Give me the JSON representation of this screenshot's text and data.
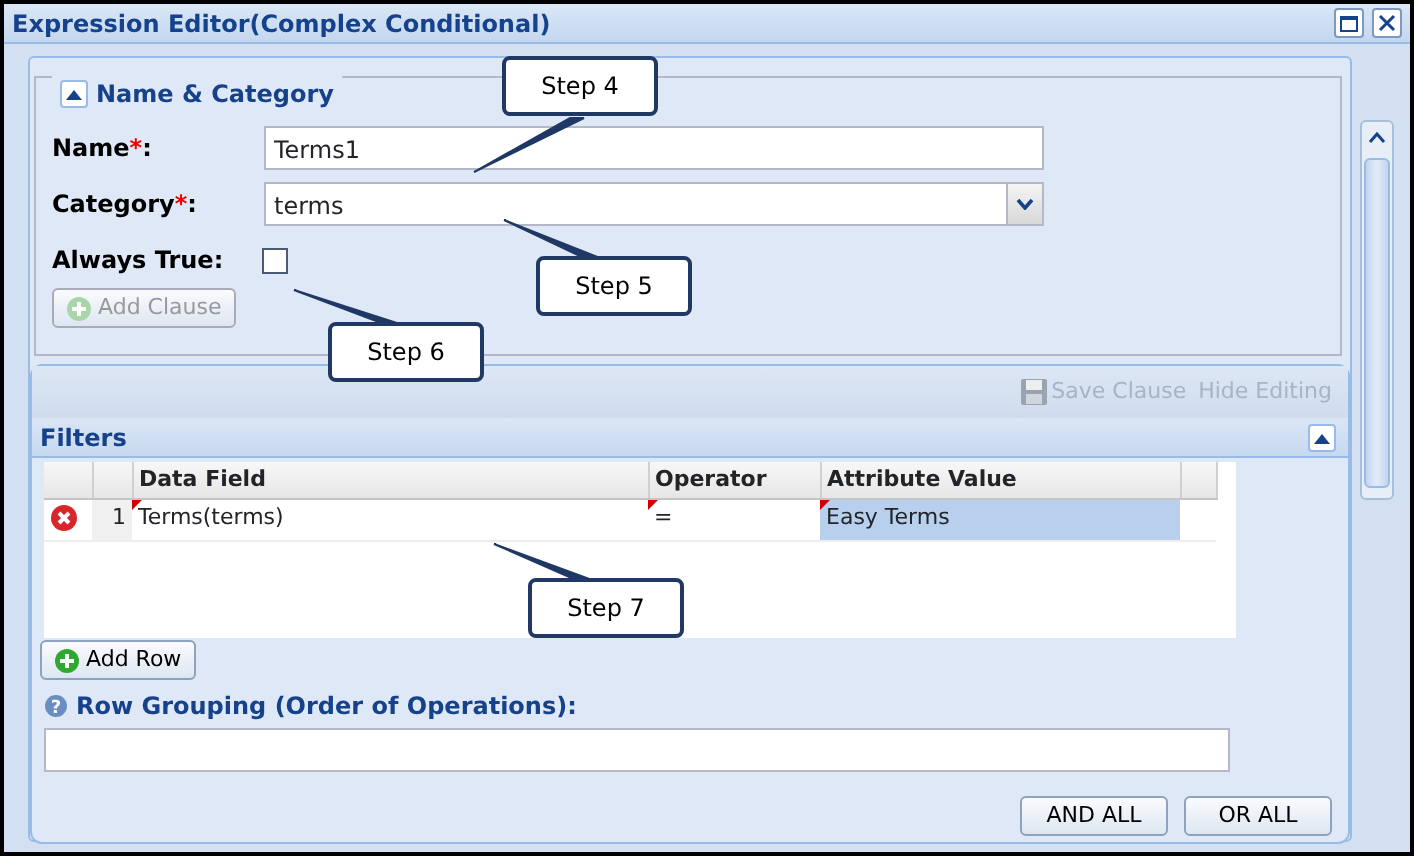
{
  "window": {
    "title": "Expression Editor(Complex Conditional)"
  },
  "name_category": {
    "legend": "Name & Category",
    "expanded": true,
    "fields": [
      {
        "kind": "text",
        "label": "Name",
        "required_mark": "*",
        "colon": ":",
        "value": "Terms1"
      },
      {
        "kind": "dropdown",
        "label": "Category",
        "required_mark": "*",
        "colon": ":",
        "value": "terms"
      },
      {
        "kind": "checkbox",
        "label": "Always True:",
        "checked": false
      }
    ],
    "add_clause": {
      "label": "Add Clause",
      "disabled": true
    }
  },
  "toolbar": [
    {
      "kind": "save",
      "label": "Save Clause",
      "disabled": true
    },
    {
      "kind": "plain",
      "label": "Hide Editing",
      "disabled": true
    }
  ],
  "filters": {
    "title": "Filters",
    "expanded": true,
    "columns": [
      "Data Field",
      "Operator",
      "Attribute Value"
    ],
    "rows": [
      {
        "number": "1",
        "cells": [
          {
            "text": "Terms(terms)",
            "dirty": true,
            "selected": false
          },
          {
            "text": "=",
            "dirty": true,
            "selected": false
          },
          {
            "text": "Easy Terms",
            "dirty": true,
            "selected": true
          }
        ]
      }
    ],
    "add_row": "Add Row"
  },
  "row_grouping": {
    "help_icon": "?",
    "label": "Row Grouping (Order of Operations):"
  },
  "buttons": [
    "AND ALL",
    "OR ALL"
  ],
  "callouts": [
    "Step 4",
    "Step 5",
    "Step 6",
    "Step 7"
  ]
}
